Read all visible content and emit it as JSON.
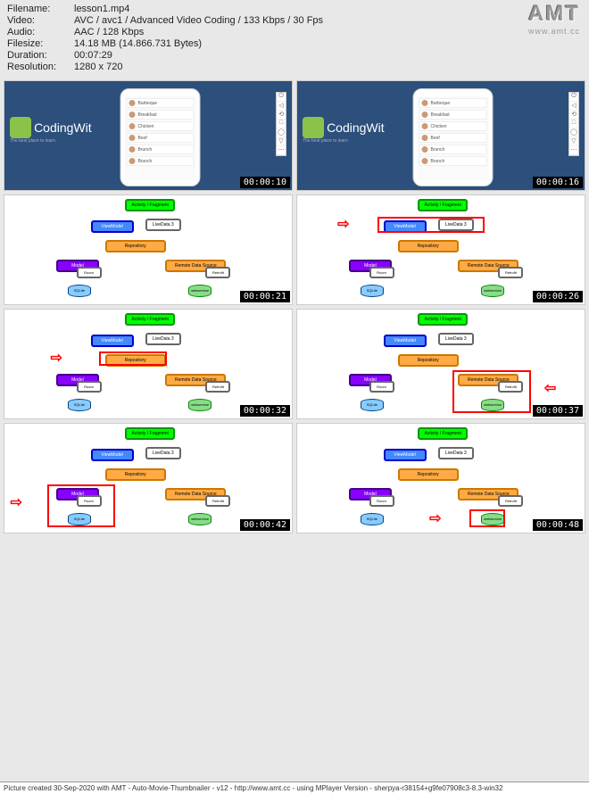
{
  "header": {
    "filename_label": "Filename:",
    "filename": "lesson1.mp4",
    "video_label": "Video:",
    "video": "AVC / avc1 / Advanced Video Coding / 133 Kbps / 30 Fps",
    "audio_label": "Audio:",
    "audio": "AAC / 128 Kbps",
    "filesize_label": "Filesize:",
    "filesize": "14.18 MB (14.866.731 Bytes)",
    "duration_label": "Duration:",
    "duration": "00:07:29",
    "resolution_label": "Resolution:",
    "resolution": "1280 x 720"
  },
  "logo": {
    "text": "AMT",
    "url": "www.amt.cc"
  },
  "brand": {
    "title": "CodingWit",
    "sub": "The best place to learn"
  },
  "phone_rows": [
    "Barbeque",
    "Breakfast",
    "Chicken",
    "Beef",
    "Brunch",
    "Brunch"
  ],
  "diagram_labels": {
    "activity": "Activity / Fragment",
    "viewmodel": "ViewModel",
    "livedata": "LiveData 3",
    "repository": "Repository",
    "model": "Model",
    "room": "Room",
    "remote": "Remote Data Source",
    "retrofit": "Retrofit",
    "sqlite": "SQLite",
    "webservice": "webservice"
  },
  "timestamps": [
    "00:00:10",
    "00:00:16",
    "00:00:21",
    "00:00:26",
    "00:00:32",
    "00:00:37",
    "00:00:42",
    "00:00:48"
  ],
  "footer": "Picture created 30-Sep-2020 with AMT - Auto-Movie-Thumbnailer - v12 - http://www.amt.cc - using MPlayer Version - sherpya-r38154+g9fe07908c3-8.3-win32"
}
